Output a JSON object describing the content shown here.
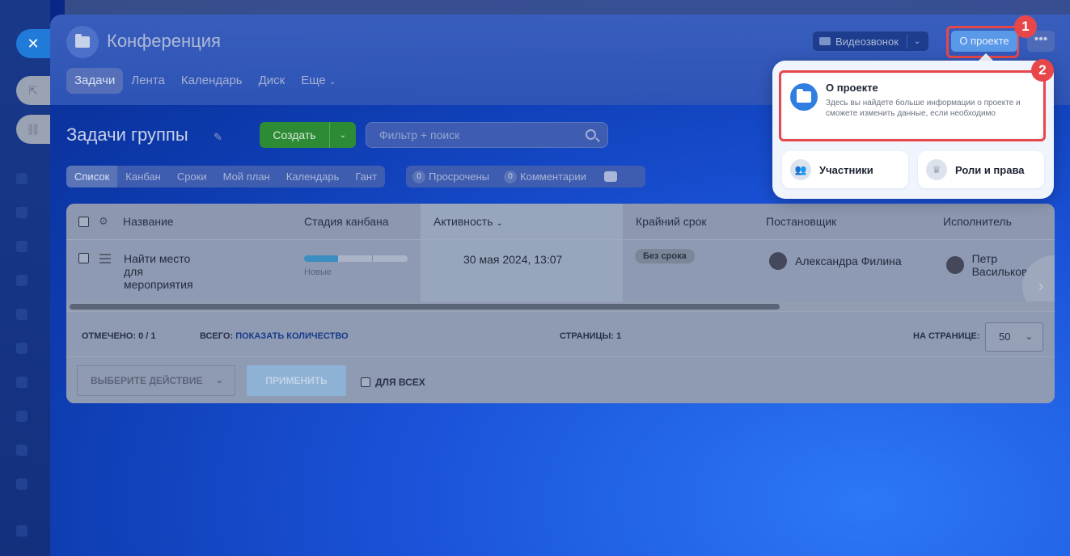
{
  "group": {
    "title": "Конференция"
  },
  "nav": {
    "items": [
      "Задачи",
      "Лента",
      "Календарь",
      "Диск",
      "Еще"
    ],
    "active_index": 0
  },
  "header_actions": {
    "video_call_label": "Видеозвонок",
    "about_label": "О проекте",
    "more_label": "•••"
  },
  "badges": {
    "first": "1",
    "second": "2"
  },
  "page": {
    "title": "Задачи группы",
    "create_label": "Создать",
    "search_placeholder": "Фильтр + поиск"
  },
  "view_tabs": [
    "Список",
    "Канбан",
    "Сроки",
    "Мой план",
    "Календарь",
    "Гант"
  ],
  "counters": {
    "overdue_count": "0",
    "overdue_label": "Просрочены",
    "comments_count": "0",
    "comments_label": "Комментарии"
  },
  "table": {
    "columns": [
      "Название",
      "Стадия канбана",
      "Активность",
      "Крайний срок",
      "Постановщик",
      "Исполнитель"
    ],
    "rows": [
      {
        "name": "Найти место для мероприятия",
        "kanban_progress": 0.33,
        "kanban_stage": "Новые",
        "activity": "30 мая 2024, 13:07",
        "deadline": "Без срока",
        "creator": "Александра Филина",
        "assignee": "Петр Васильков"
      }
    ]
  },
  "footer": {
    "checked_label": "ОТМЕЧЕНО:",
    "checked_value": "0 / 1",
    "total_label": "ВСЕГО:",
    "total_link": "ПОКАЗАТЬ КОЛИЧЕСТВО",
    "pages_label": "СТРАНИЦЫ:",
    "pages_value": "1",
    "per_page_label": "НА СТРАНИЦЕ:",
    "per_page_value": "50",
    "action_select": "ВЫБЕРИТЕ ДЕЙСТВИЕ",
    "apply_label": "ПРИМЕНИТЬ",
    "for_all_label": "ДЛЯ ВСЕХ"
  },
  "popup": {
    "main_title": "О проекте",
    "main_desc": "Здесь вы найдете больше информации о проекте и сможете изменить данные, если необходимо",
    "members_label": "Участники",
    "roles_label": "Роли и права"
  },
  "colors": {
    "highlight": "#e8474a",
    "accent": "#2f7fe3",
    "create_green": "#2d8a35"
  }
}
